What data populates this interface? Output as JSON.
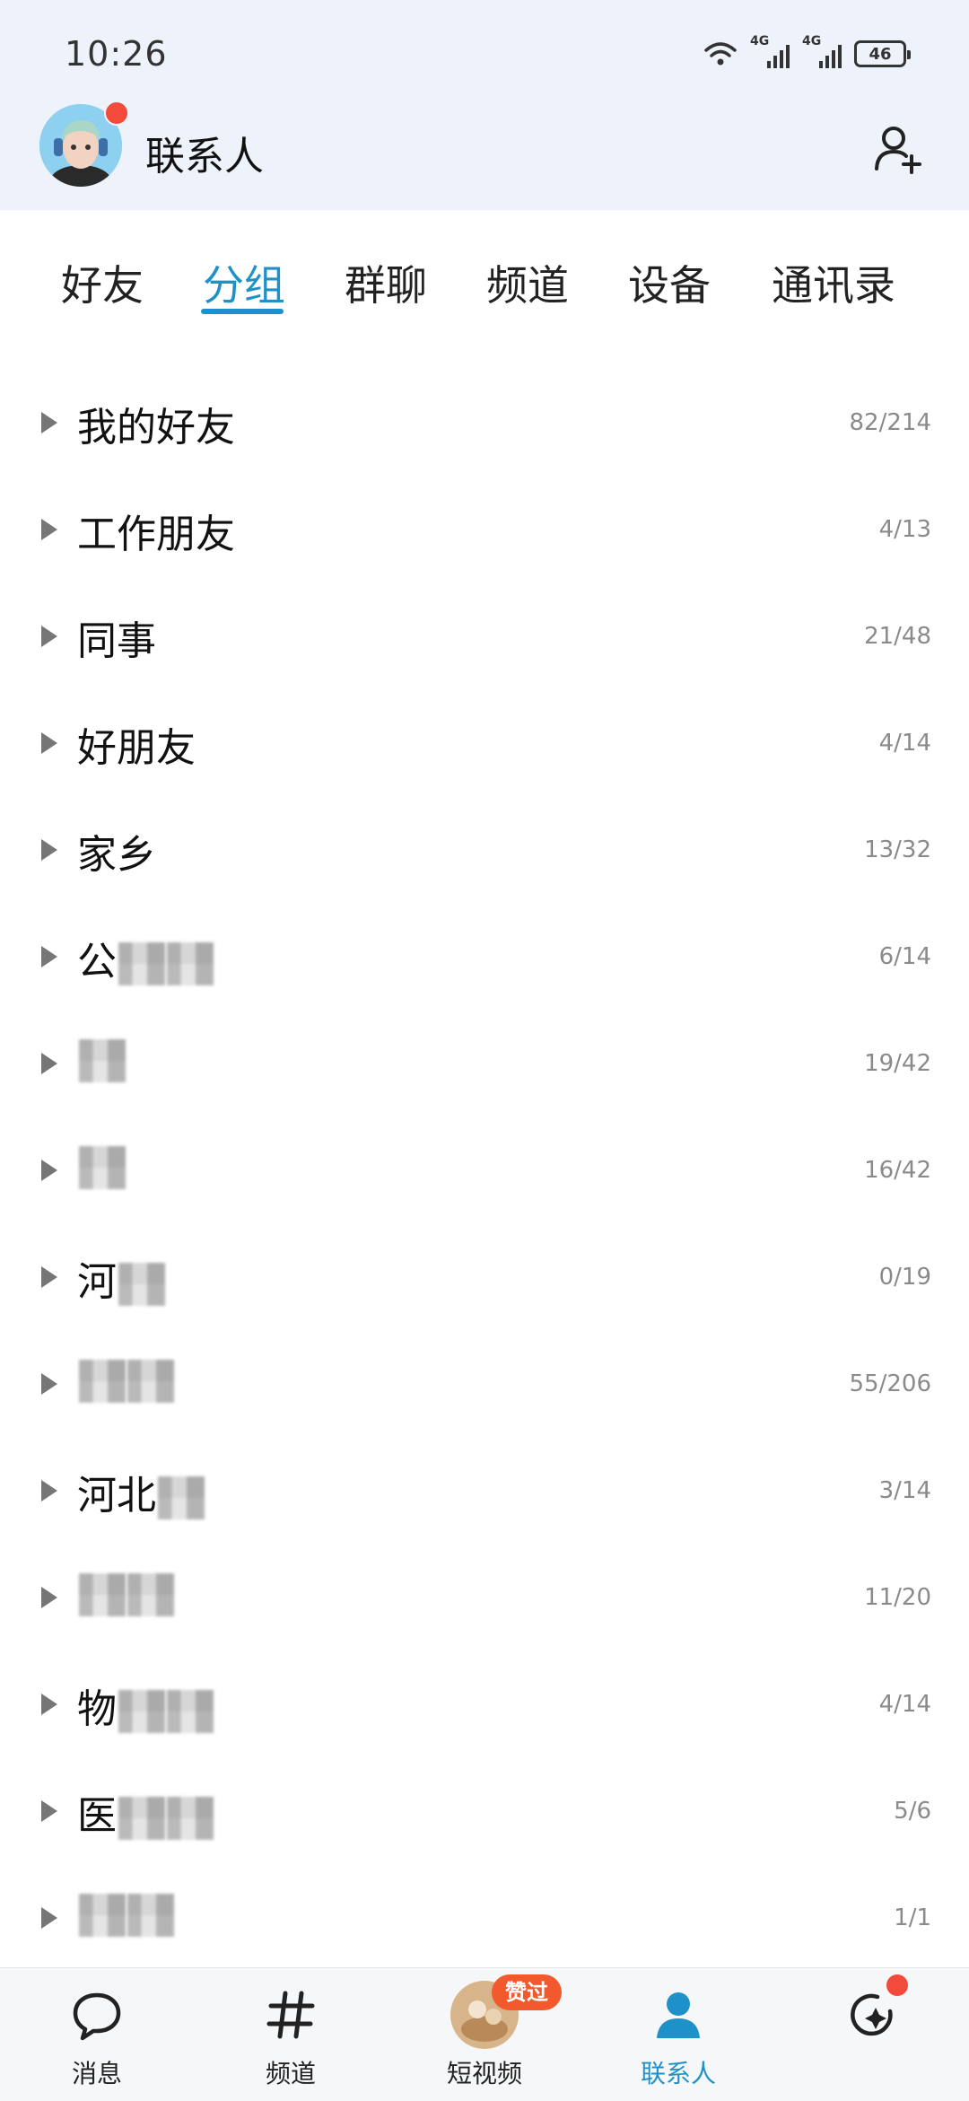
{
  "status_bar": {
    "time": "10:26",
    "network_label_1": "4G",
    "network_label_2": "4G",
    "battery": "46"
  },
  "header": {
    "title": "联系人"
  },
  "tabs": [
    "好友",
    "分组",
    "群聊",
    "频道",
    "设备",
    "通讯录"
  ],
  "active_tab": "分组",
  "groups": [
    {
      "name": "我的好友",
      "count": "82/214"
    },
    {
      "name": "工作朋友",
      "count": "4/13"
    },
    {
      "name": "同事",
      "count": "21/48"
    },
    {
      "name": "好朋友",
      "count": "4/14"
    },
    {
      "name": "家乡",
      "count": "13/32"
    },
    {
      "name": "公",
      "count": "6/14"
    },
    {
      "name": "",
      "count": "19/42"
    },
    {
      "name": "",
      "count": "16/42"
    },
    {
      "name": "河",
      "count": "0/19"
    },
    {
      "name": "",
      "count": "55/206"
    },
    {
      "name": "河北",
      "count": "3/14"
    },
    {
      "name": "",
      "count": "11/20"
    },
    {
      "name": "物",
      "count": "4/14"
    },
    {
      "name": "医",
      "count": "5/6"
    },
    {
      "name": "",
      "count": "1/1"
    }
  ],
  "bottom_nav": [
    {
      "label": "消息",
      "icon": "chat-bubble-icon"
    },
    {
      "label": "频道",
      "icon": "hashtag-icon"
    },
    {
      "label": "短视频",
      "icon": "video-thumbnail-icon",
      "badge": "赞过"
    },
    {
      "label": "联系人",
      "icon": "person-icon"
    },
    {
      "label": "",
      "icon": "refresh-sparkle-icon"
    }
  ],
  "colors": {
    "accent": "#1e92c8",
    "header_bg": "#eef3fb",
    "badge_red": "#f24a3b"
  }
}
